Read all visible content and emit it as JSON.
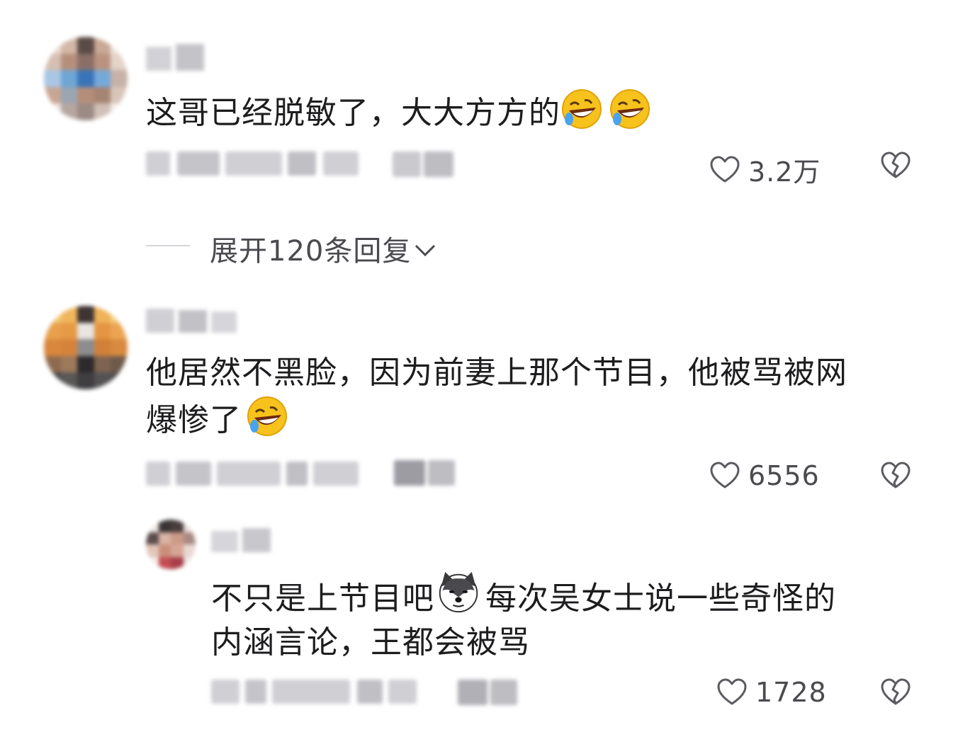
{
  "comments": [
    {
      "text": "这哥已经脱敏了，大大方方的",
      "emojis": [
        "rofl-emoji",
        "rofl-emoji"
      ],
      "likes": "3.2万",
      "expand_replies": "展开120条回复"
    },
    {
      "text_line1": "他居然不黑脸，因为前妻上那个节目，他被骂被网",
      "text_line2": "爆惨了",
      "emojis": [
        "rofl-emoji"
      ],
      "likes": "6556"
    }
  ],
  "reply": {
    "text_part1": "不只是上节目吧",
    "emoji": "husky-dog-emoji",
    "text_part2": "每次吴女士说一些奇怪的",
    "text_line2": "内涵言论，王都会被骂",
    "likes": "1728"
  },
  "icons": {
    "like": "heart-icon",
    "dislike": "broken-heart-icon",
    "expand": "chevron-down-icon"
  },
  "colors": {
    "text": "#1d1d1f",
    "meta": "#4a4a4f",
    "emoji_face": "#f7c21b"
  }
}
